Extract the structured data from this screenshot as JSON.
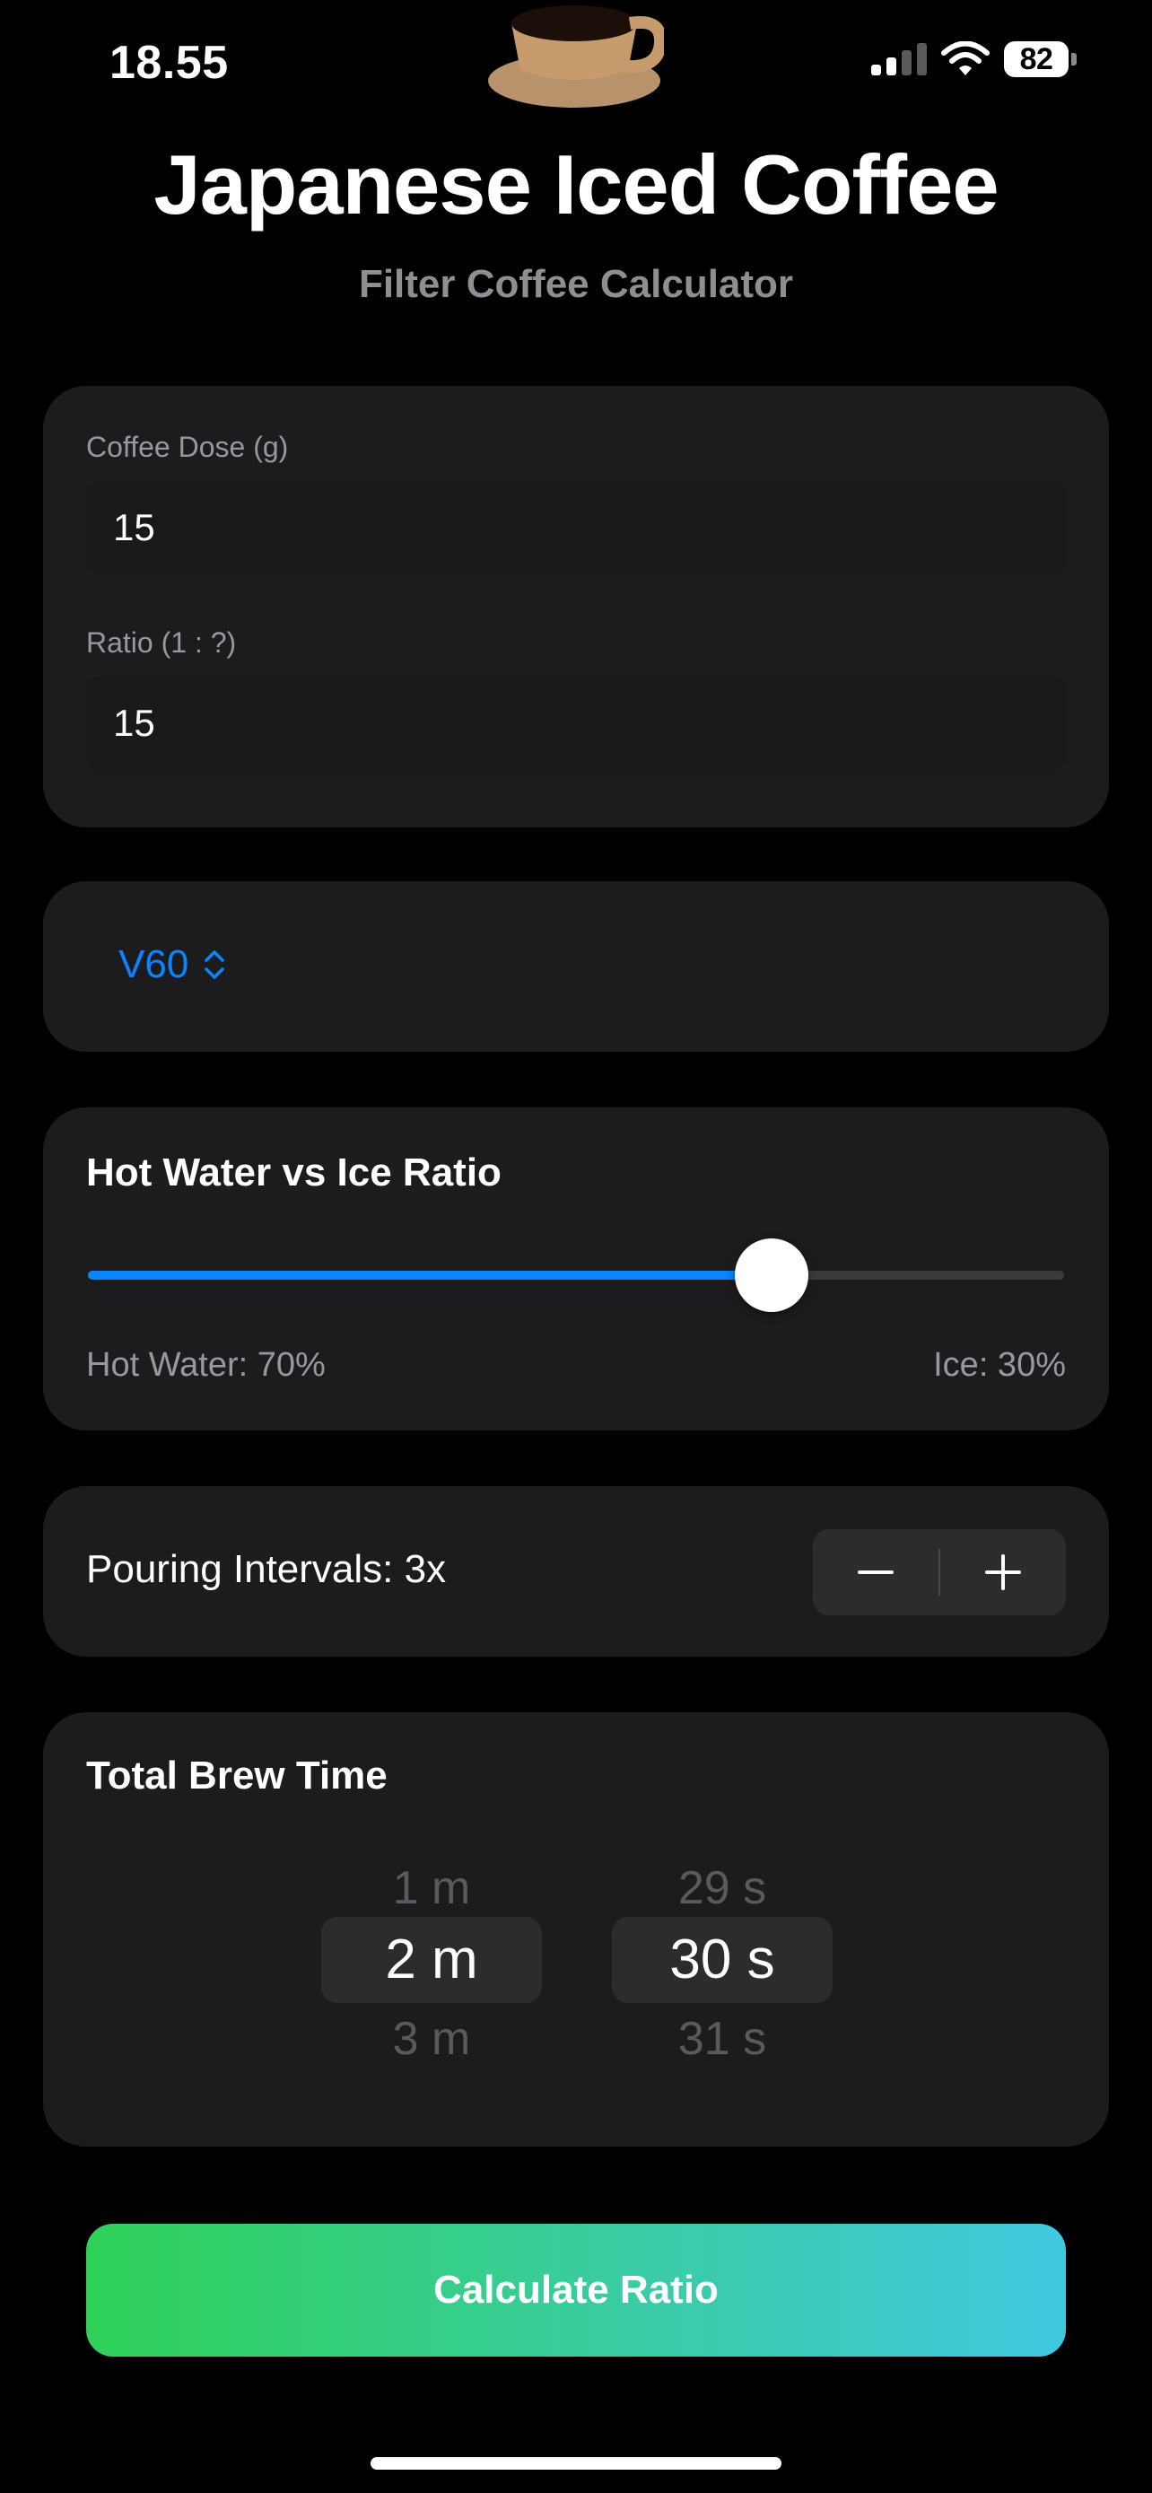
{
  "status_bar": {
    "time": "18.55",
    "battery_level": "82",
    "icons": [
      "signal-icon",
      "wifi-icon",
      "battery-icon"
    ]
  },
  "header": {
    "title": "Japanese Iced Coffee",
    "subtitle": "Filter Coffee Calculator",
    "icon": "coffee-cup-icon"
  },
  "inputs": {
    "dose_label": "Coffee Dose (g)",
    "dose_value": "15",
    "ratio_label": "Ratio (1 : ?)",
    "ratio_value": "15"
  },
  "brewer": {
    "selected": "V60",
    "icon": "chevron-up-down-icon"
  },
  "ice_ratio": {
    "title": "Hot Water vs Ice Ratio",
    "hot_water_fraction": 0.7,
    "hot_water_label": "Hot Water: 70%",
    "ice_label": "Ice: 30%"
  },
  "pouring": {
    "label": "Pouring Intervals: 3x",
    "decrement_icon": "minus-icon",
    "increment_icon": "plus-icon"
  },
  "brew_time": {
    "title": "Total Brew Time",
    "minutes": {
      "prev": "1 m",
      "selected": "2 m",
      "next": "3 m"
    },
    "seconds": {
      "prev": "29 s",
      "selected": "30 s",
      "next": "31 s"
    }
  },
  "actions": {
    "calculate_label": "Calculate Ratio"
  },
  "colors": {
    "background": "#000000",
    "card": "#1c1c1e",
    "accent_blue": "#0a84ff",
    "gradient_start": "#30d158",
    "gradient_end": "#40c8e0"
  }
}
